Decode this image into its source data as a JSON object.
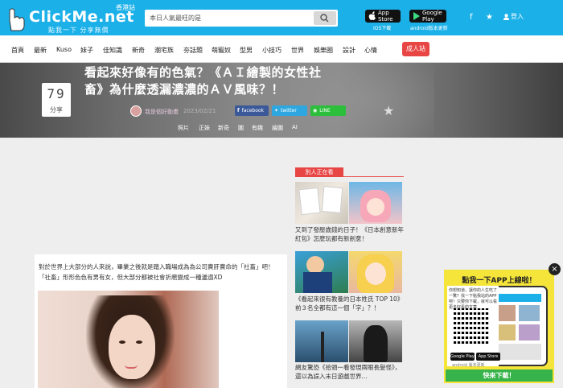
{
  "header": {
    "brand": "ClickMe.net",
    "tagline": "點我一下 分享無價",
    "edition": "香港站",
    "search_placeholder": "本日人氣最旺的是",
    "ios_store": "App Store",
    "ios_caption": "IOS下載",
    "android_store": "Google Play",
    "android_caption": "android版本更新",
    "login": "登入",
    "colors": {
      "bar": "#1cb0e8"
    }
  },
  "nav": {
    "items": [
      "首頁",
      "最新",
      "Kuso",
      "妹子",
      "佳知識",
      "新奇",
      "潮宅族",
      "夯話題",
      "萌寵奴",
      "型男",
      "小技巧",
      "世界",
      "娛樂圈",
      "設計",
      "心情"
    ],
    "adult": "成人站"
  },
  "hero": {
    "share_count": "79",
    "share_label": "分享",
    "title": "看起來好像有的色氣？《ＡＩ繪製的女性社畜》為什麼透漏濃濃的ＡＶ風味？！",
    "author": "我是個好動畫",
    "date": "2023/02/21",
    "share_buttons": [
      "facebook",
      "twitter",
      "LINE"
    ],
    "tags": [
      "照片",
      "正妹",
      "新奇",
      "圖",
      "有趣",
      "繪圖",
      "AI"
    ]
  },
  "article": {
    "text": "對於世界上大部分的人來說，畢業之後就是踏入職場成為為公司賣肝賣命的「社畜」吧！「社畜」形形色色有男有女，但大部分都被社會折磨變成一種邋遢XD"
  },
  "sidebar": {
    "title": "別人正在看",
    "items": [
      {
        "caption": "又到了發壓歲錢的日子！《日本創意新年紅包》怎麼玩都有新創意！"
      },
      {
        "caption": "《看起來很有教養的日本姓氏 TOP 10》前３名全都有這一個「字」？！"
      },
      {
        "caption": "網友驚恐《拾頭一看發現兩眼長髮怪》，還以為誤入末日遊戲世界..."
      }
    ]
  },
  "ad": {
    "headline": "點我一下APP上線啦！",
    "body": "你想知道，讓你的人生吃了一驚？找一下點我站的APP吧！只要你下載，就可以看更多好看的文章",
    "store_buttons": [
      "Google Play",
      "App Store"
    ],
    "footnote": "android 版本更新",
    "download": "快來下載！",
    "close": "×"
  }
}
